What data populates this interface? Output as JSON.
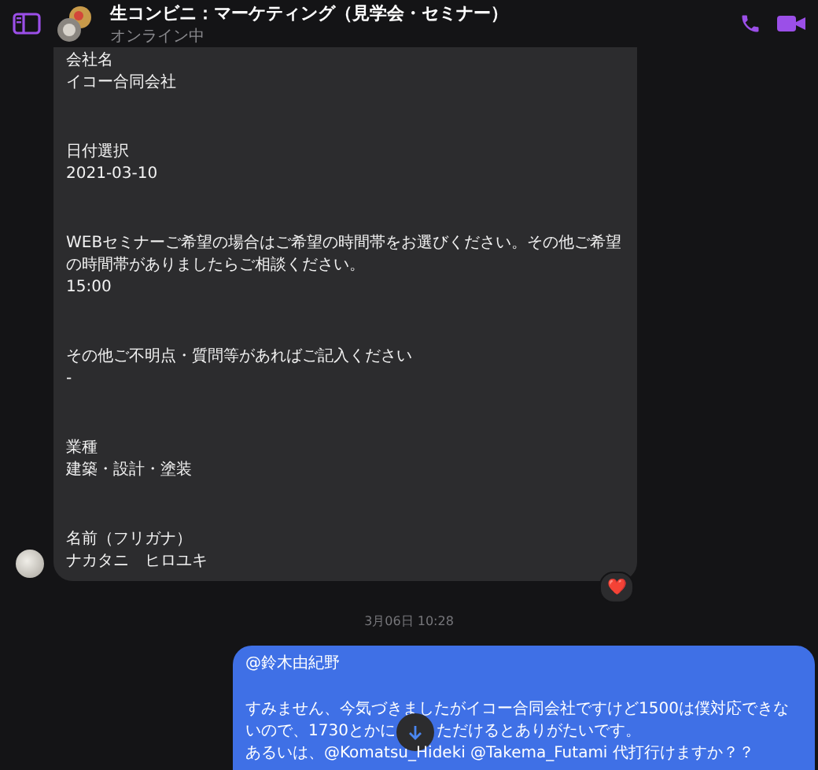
{
  "header": {
    "title": "生コンビニ：マーケティング（見学会・セミナー）",
    "status": "オンライン中"
  },
  "incoming": {
    "fields": [
      {
        "label": "会社名",
        "value": "イコー合同会社"
      },
      {
        "label": "日付選択",
        "value": "2021-03-10"
      },
      {
        "label": "WEBセミナーご希望の場合はご希望の時間帯をお選びください。その他ご希望の時間帯がありましたらご相談ください。",
        "value": "15:00"
      },
      {
        "label": "その他ご不明点・質問等があればご記入ください",
        "value": "-"
      },
      {
        "label": "業種",
        "value": "建築・設計・塗装"
      },
      {
        "label": "名前（フリガナ）",
        "value": "ナカタニ　ヒロユキ"
      }
    ],
    "reaction": "❤️"
  },
  "timestamp": "3月06日 10:28",
  "outgoing": {
    "mention": "@鈴木由紀野",
    "lines": [
      {
        "kind": "text",
        "text": "すみません、今気づきましたがイコー合同会社ですけど1500は僕対応できな"
      },
      {
        "kind": "split",
        "before": "いので、1730とかに",
        "after": "ただけるとありがたいです。"
      },
      {
        "kind": "text",
        "text": "あるいは、@Komatsu_Hideki @Takema_Futami 代打行けますか？？"
      }
    ]
  }
}
